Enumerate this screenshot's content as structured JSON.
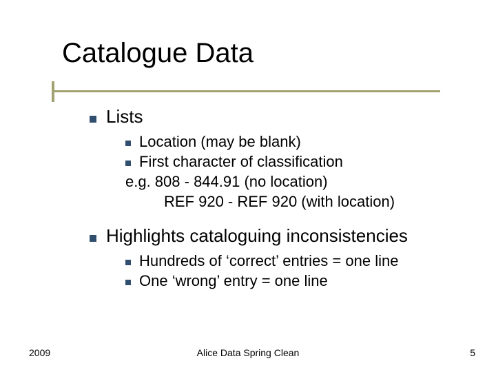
{
  "title": "Catalogue Data",
  "bullets": {
    "b1": "Lists",
    "b1_1": "Location (may be blank)",
    "b1_2": "First character of classification",
    "b1_ex1": "e.g. 808 - 844.91 (no location)",
    "b1_ex2": "REF 920 - REF 920 (with location)",
    "b2": "Highlights cataloguing inconsistencies",
    "b2_1": "Hundreds of ‘correct’ entries = one line",
    "b2_2": "One ‘wrong’ entry = one line"
  },
  "footer": {
    "left": "2009",
    "center": "Alice Data Spring Clean",
    "right": "5"
  }
}
